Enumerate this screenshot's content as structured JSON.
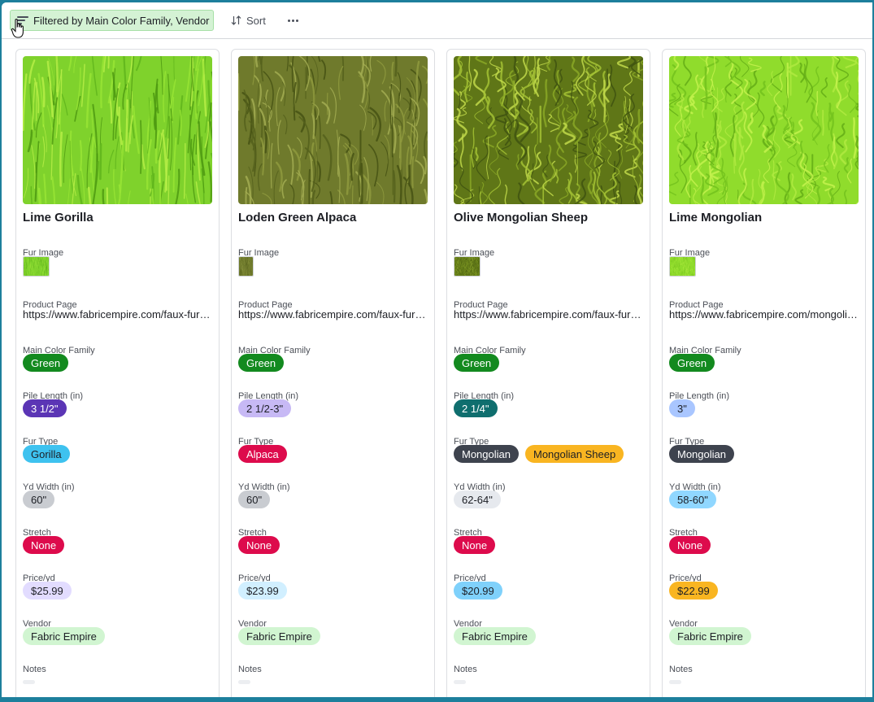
{
  "toolbar": {
    "filter_label": "Filtered by Main Color Family, Vendor",
    "sort_label": "Sort"
  },
  "labels": {
    "fur_image": "Fur Image",
    "product_page": "Product Page",
    "main_color_family": "Main Color Family",
    "pile_length": "Pile Length (in)",
    "fur_type": "Fur Type",
    "yd_width": "Yd Width (in)",
    "stretch": "Stretch",
    "price": "Price/yd",
    "vendor": "Vendor",
    "notes": "Notes"
  },
  "cards": [
    {
      "title": "Lime Gorilla",
      "product_page": "https://www.fabricempire.com/faux-fur/lime-gorilla-shag",
      "main_color_family": "Green",
      "pile_length": "3 1/2\"",
      "fur_type": [
        "Gorilla"
      ],
      "yd_width": "60\"",
      "stretch": "None",
      "price": "$25.99",
      "vendor": "Fabric Empire",
      "notes": "",
      "swatch": "lime-shag"
    },
    {
      "title": "Loden Green Alpaca",
      "product_page": "https://www.fabricempire.com/faux-fur/loden-green-alpaca",
      "main_color_family": "Green",
      "pile_length": "2 1/2-3\"",
      "fur_type": [
        "Alpaca"
      ],
      "yd_width": "60\"",
      "stretch": "None",
      "price": "$23.99",
      "vendor": "Fabric Empire",
      "notes": "",
      "swatch": "loden-alpaca"
    },
    {
      "title": "Olive Mongolian Sheep",
      "product_page": "https://www.fabricempire.com/faux-fur/olive-mongolian-sheep",
      "main_color_family": "Green",
      "pile_length": "2 1/4\"",
      "fur_type": [
        "Mongolian",
        "Mongolian Sheep"
      ],
      "yd_width": "62-64\"",
      "stretch": "None",
      "price": "$20.99",
      "vendor": "Fabric Empire",
      "notes": "",
      "swatch": "olive-curly"
    },
    {
      "title": "Lime Mongolian",
      "product_page": "https://www.fabricempire.com/mongolian-faux-fur/lime",
      "main_color_family": "Green",
      "pile_length": "3\"",
      "fur_type": [
        "Mongolian"
      ],
      "yd_width": "58-60\"",
      "stretch": "None",
      "price": "$22.99",
      "vendor": "Fabric Empire",
      "notes": "",
      "swatch": "lime-curly"
    }
  ],
  "colors": {
    "toolbar_filter_bg": "#d4f2d4",
    "frame_border": "#1d7f9c",
    "green": "#138a1f",
    "pile": {
      "3 1/2\"": [
        "#5b35b5",
        "#ffffff"
      ],
      "2 1/2-3\"": [
        "#c7b9f5",
        "#1d1f25"
      ],
      "2 1/4\"": [
        "#0f6e6e",
        "#ffffff"
      ],
      "3\"": [
        "#a9c6ff",
        "#1d1f25"
      ]
    },
    "fur_type": {
      "Gorilla": [
        "#3ec2ef",
        "#1d1f25"
      ],
      "Alpaca": [
        "#dd0b4c",
        "#ffffff"
      ],
      "Mongolian": [
        "#3e434e",
        "#ffffff"
      ],
      "Mongolian Sheep": [
        "#f9b521",
        "#1d1f25"
      ]
    },
    "yd_width": {
      "60\"": [
        "#c9ccd1",
        "#1d1f25"
      ],
      "62-64\"": [
        "#e6e9ee",
        "#1d1f25"
      ],
      "58-60\"": [
        "#90d7ff",
        "#1d1f25"
      ]
    },
    "stretch": {
      "None": [
        "#dd0b4c",
        "#ffffff"
      ]
    },
    "price": {
      "$25.99": [
        "#e2dcff",
        "#1d1f25"
      ],
      "$23.99": [
        "#d1efff",
        "#1d1f25"
      ],
      "$20.99": [
        "#7fd1fb",
        "#1d1f25"
      ],
      "$22.99": [
        "#f9b521",
        "#1d1f25"
      ]
    },
    "vendor": {
      "Fabric Empire": [
        "#d1f5d1",
        "#1d1f25"
      ]
    }
  }
}
